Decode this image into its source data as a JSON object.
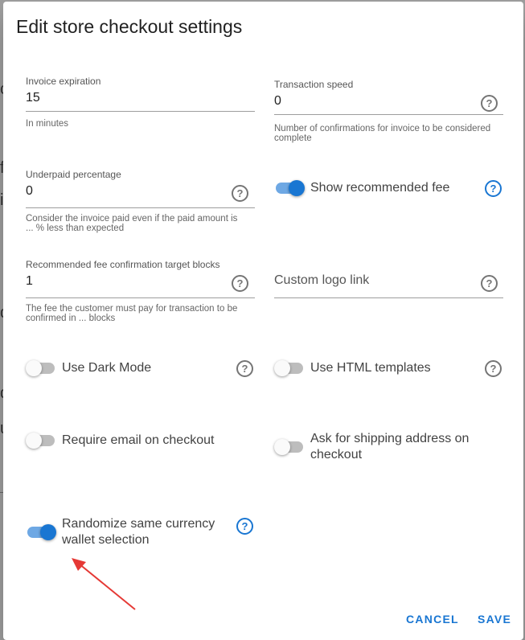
{
  "dialog": {
    "title": "Edit store checkout settings"
  },
  "fields": {
    "invoice_expiration": {
      "label": "Invoice expiration",
      "value": "15",
      "hint": "In minutes"
    },
    "transaction_speed": {
      "label": "Transaction speed",
      "value": "0",
      "hint_line1": "Number of confirmations for invoice to be considered",
      "hint_line2": "complete"
    },
    "underpaid_percentage": {
      "label": "Underpaid percentage",
      "value": "0",
      "hint_line1": "Consider the invoice paid even if the paid amount is",
      "hint_line2": "... % less than expected"
    },
    "recommended_fee_blocks": {
      "label": "Recommended fee confirmation target blocks",
      "value": "1",
      "hint_line1": "The fee the customer must pay for transaction to be",
      "hint_line2": "confirmed in ... blocks"
    },
    "custom_logo_link": {
      "placeholder": "Custom logo link"
    }
  },
  "toggles": {
    "show_recommended_fee": {
      "label": "Show recommended fee",
      "on": true
    },
    "use_dark_mode": {
      "label": "Use Dark Mode",
      "on": false
    },
    "use_html_templates": {
      "label": "Use HTML templates",
      "on": false
    },
    "require_email": {
      "label": "Require email on checkout",
      "on": false
    },
    "ask_shipping_line1": "Ask for shipping address on",
    "ask_shipping_line2": "checkout",
    "ask_shipping_on": false,
    "randomize_line1": "Randomize same currency",
    "randomize_line2": "wallet selection",
    "randomize_on": true
  },
  "help_icon_glyph": "?",
  "buttons": {
    "cancel": "CANCEL",
    "save": "SAVE"
  },
  "background_fragments": [
    "c",
    "f",
    "i",
    "d",
    "d",
    "u"
  ],
  "colors": {
    "accent": "#1976d2",
    "annotation_arrow": "#e53935"
  }
}
